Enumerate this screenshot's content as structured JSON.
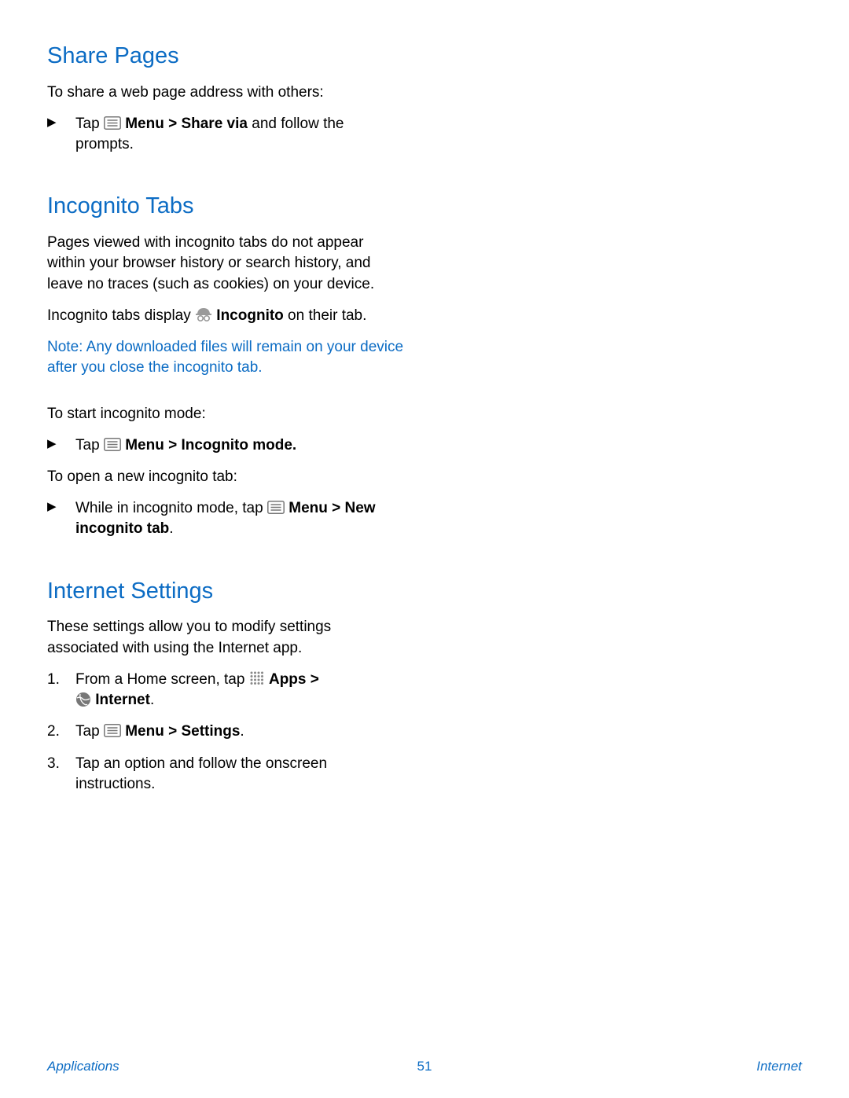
{
  "section_share": {
    "heading": "Share Pages",
    "intro": "To share a web page address with others:",
    "step": {
      "pre": "Tap ",
      "bold1": "Menu > Share via",
      "post": " and follow the prompts."
    }
  },
  "section_incog": {
    "heading": "Incognito Tabs",
    "intro": "Pages viewed with incognito tabs do not appear within your browser history or search history, and leave no traces (such as cookies) on your device.",
    "display_pre": "Incognito tabs display ",
    "display_bold": "Incognito",
    "display_post": " on their tab.",
    "note_label": "Note",
    "note_body": ": Any downloaded files will remain on your device after you close the incognito tab.",
    "start_label": "To start incognito mode:",
    "start_step": {
      "pre": "Tap ",
      "bold": "Menu > Incognito mode."
    },
    "open_label": "To open a new incognito tab:",
    "open_step": {
      "pre": "While in incognito mode, tap ",
      "bold1": "Menu > ",
      "bold2": "New incognito tab",
      "post": "."
    }
  },
  "section_settings": {
    "heading": "Internet Settings",
    "intro": "These settings allow you to modify settings associated with using the Internet app.",
    "step1": {
      "num": "1.",
      "pre": "From a Home screen, tap ",
      "bold_apps": "Apps > ",
      "bold_internet": "Internet",
      "post": "."
    },
    "step2": {
      "num": "2.",
      "pre": "Tap ",
      "bold": "Menu > Settings",
      "post": "."
    },
    "step3": {
      "num": "3.",
      "text": "Tap an option and follow the onscreen instructions."
    }
  },
  "footer": {
    "left": "Applications",
    "center": "51",
    "right": "Internet"
  }
}
